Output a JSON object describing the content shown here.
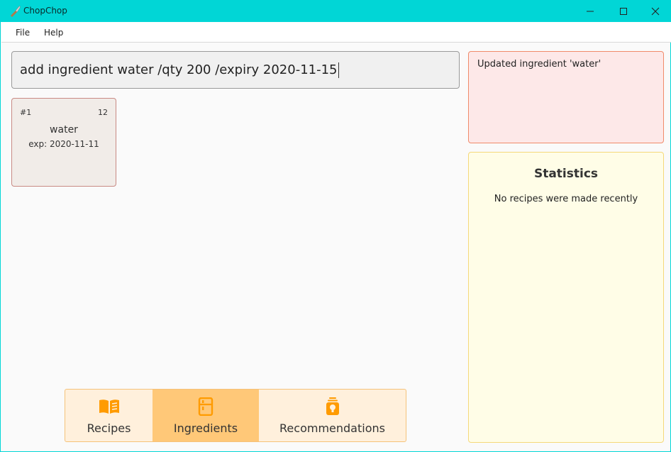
{
  "window": {
    "title": "ChopChop",
    "icons": {
      "app": "knife-icon",
      "minimize": "minimize-icon",
      "maximize": "maximize-icon",
      "close": "close-icon"
    }
  },
  "menu": {
    "file": "File",
    "help": "Help"
  },
  "command": {
    "value": "add ingredient water /qty 200 /expiry 2020-11-15"
  },
  "ingredients": [
    {
      "index": "#1",
      "quantity": "12",
      "name": "water",
      "expiry": "exp: 2020-11-11"
    }
  ],
  "result": {
    "message": "Updated ingredient 'water'"
  },
  "statistics": {
    "title": "Statistics",
    "message": "No recipes were made recently"
  },
  "tabs": [
    {
      "label": "Recipes",
      "icon": "book-icon",
      "selected": false
    },
    {
      "label": "Ingredients",
      "icon": "fridge-icon",
      "selected": true
    },
    {
      "label": "Recommendations",
      "icon": "lightbulb-jar-icon",
      "selected": false
    }
  ],
  "colors": {
    "titlebar": "#01d6d6",
    "accent": "#ff9b00",
    "tab_selected": "#ffc878",
    "result_bg": "#fde8e8",
    "stats_bg": "#fffde7"
  }
}
